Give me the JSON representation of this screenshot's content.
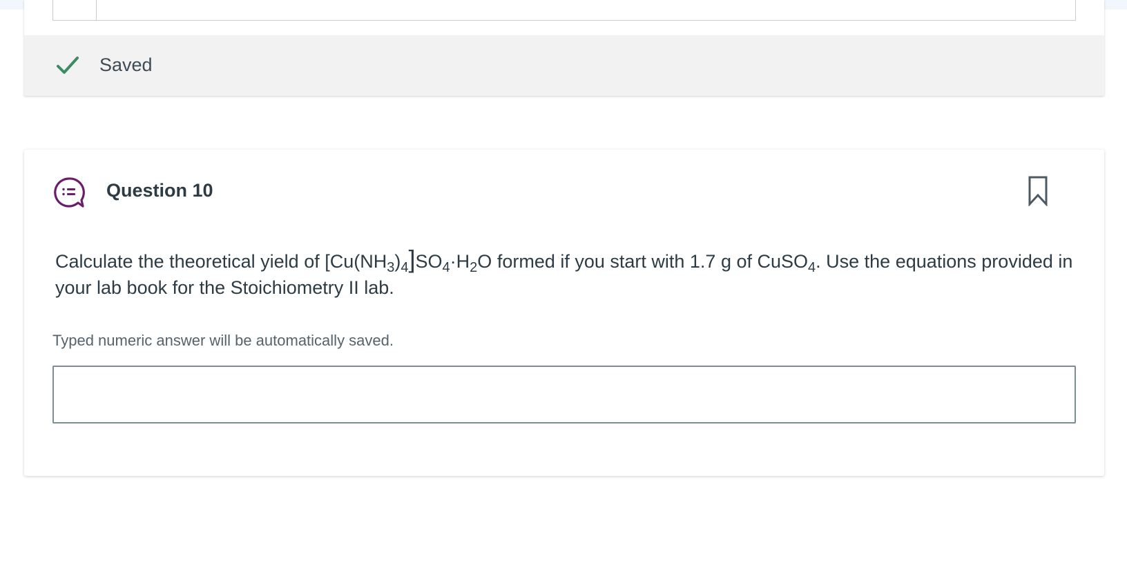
{
  "previous_question": {
    "saved_status": "Saved",
    "saved_color": "#3d8b63"
  },
  "question": {
    "title": "Question 10",
    "icon": "chat-list-icon",
    "icon_color": "#6b1d6b",
    "bookmark_icon": "bookmark-icon",
    "text_before": "Calculate the theoretical yield of ",
    "formula_complex": {
      "open_bracket": "[",
      "cu": "Cu(NH",
      "nh_sub": "3",
      "close_paren": ")",
      "paren_sub": "4",
      "close_bracket": "]",
      "so": "SO",
      "so_sub": "4",
      "dot_h": "·H",
      "h_sub": "2",
      "o": "O"
    },
    "text_middle": " formed if you start with 1.7 g of CuSO",
    "cuso_sub": "4",
    "text_after": ". Use the equations provided in your lab book for the Stoichiometry II lab.",
    "hint": "Typed numeric answer will be automatically saved.",
    "answer_value": ""
  }
}
